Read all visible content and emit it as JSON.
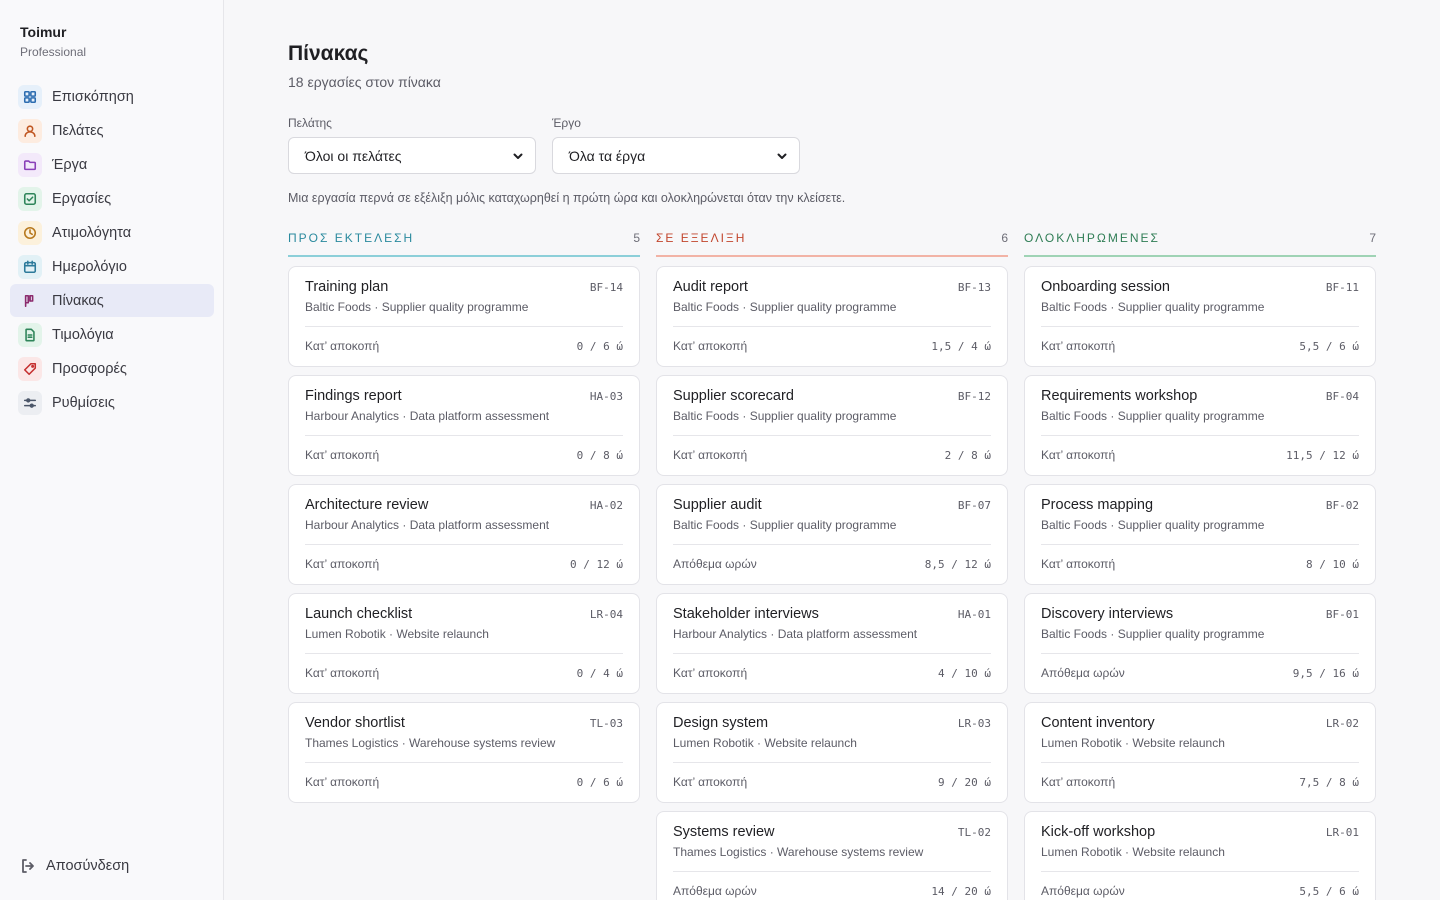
{
  "sidebar": {
    "brand": "Toimur",
    "plan": "Professional",
    "items": [
      {
        "label": "Επισκόπηση",
        "icon": "grid-icon",
        "color": "#2b6cb0",
        "bg": "#e6f0fa"
      },
      {
        "label": "Πελάτες",
        "icon": "user-icon",
        "color": "#c05621",
        "bg": "#fdece0"
      },
      {
        "label": "Έργα",
        "icon": "folder-icon",
        "color": "#8a3fb8",
        "bg": "#f3e9fa"
      },
      {
        "label": "Εργασίες",
        "icon": "checkbox-icon",
        "color": "#2f855a",
        "bg": "#e3f4ea"
      },
      {
        "label": "Ατιμολόγητα",
        "icon": "clock-icon",
        "color": "#b7791f",
        "bg": "#fcf1dc"
      },
      {
        "label": "Ημερολόγιο",
        "icon": "calendar-icon",
        "color": "#2c7a9b",
        "bg": "#e2f1f6"
      },
      {
        "label": "Πίνακας",
        "icon": "kanban-icon",
        "color": "#8b2b6d",
        "bg": "transparent",
        "active": true
      },
      {
        "label": "Τιμολόγια",
        "icon": "invoice-icon",
        "color": "#2f855a",
        "bg": "#e3f4ea"
      },
      {
        "label": "Προσφορές",
        "icon": "tag-icon",
        "color": "#c53030",
        "bg": "#fbe7e7"
      },
      {
        "label": "Ρυθμίσεις",
        "icon": "sliders-icon",
        "color": "#4a5568",
        "bg": "#eceef2"
      }
    ],
    "logout": "Αποσύνδεση"
  },
  "header": {
    "title": "Πίνακας",
    "subtitle": "18 εργασίες στον πίνακα"
  },
  "filters": {
    "client_label": "Πελάτης",
    "client_value": "Όλοι οι πελάτες",
    "project_label": "Έργο",
    "project_value": "Όλα τα έργα"
  },
  "hint": "Μια εργασία περνά σε εξέλιξη μόλις καταχωρηθεί η πρώτη ώρα και ολοκληρώνεται όταν την κλείσετε.",
  "columns": [
    {
      "title": "ΠΡΟΣ ΕΚΤΕΛΕΣΗ",
      "count": "5",
      "color": "#2a8a9e",
      "accent": "#8ccfd9",
      "cards": [
        {
          "title": "Training plan",
          "code": "BF-14",
          "meta": "Baltic Foods · Supplier quality programme",
          "status": "Κατ’ αποκοπή",
          "hours": "0 / 6 ώ"
        },
        {
          "title": "Findings report",
          "code": "HA-03",
          "meta": "Harbour Analytics · Data platform assessment",
          "status": "Κατ’ αποκοπή",
          "hours": "0 / 8 ώ"
        },
        {
          "title": "Architecture review",
          "code": "HA-02",
          "meta": "Harbour Analytics · Data platform assessment",
          "status": "Κατ’ αποκοπή",
          "hours": "0 / 12 ώ"
        },
        {
          "title": "Launch checklist",
          "code": "LR-04",
          "meta": "Lumen Robotik · Website relaunch",
          "status": "Κατ’ αποκοπή",
          "hours": "0 / 4 ώ"
        },
        {
          "title": "Vendor shortlist",
          "code": "TL-03",
          "meta": "Thames Logistics · Warehouse systems review",
          "status": "Κατ’ αποκοπή",
          "hours": "0 / 6 ώ"
        }
      ]
    },
    {
      "title": "ΣΕ ΕΞΕΛΙΞΗ",
      "count": "6",
      "color": "#c2452d",
      "accent": "#f2b3a6",
      "cards": [
        {
          "title": "Audit report",
          "code": "BF-13",
          "meta": "Baltic Foods · Supplier quality programme",
          "status": "Κατ’ αποκοπή",
          "hours": "1,5 / 4 ώ"
        },
        {
          "title": "Supplier scorecard",
          "code": "BF-12",
          "meta": "Baltic Foods · Supplier quality programme",
          "status": "Κατ’ αποκοπή",
          "hours": "2 / 8 ώ"
        },
        {
          "title": "Supplier audit",
          "code": "BF-07",
          "meta": "Baltic Foods · Supplier quality programme",
          "status": "Απόθεμα ωρών",
          "hours": "8,5 / 12 ώ"
        },
        {
          "title": "Stakeholder interviews",
          "code": "HA-01",
          "meta": "Harbour Analytics · Data platform assessment",
          "status": "Κατ’ αποκοπή",
          "hours": "4 / 10 ώ"
        },
        {
          "title": "Design system",
          "code": "LR-03",
          "meta": "Lumen Robotik · Website relaunch",
          "status": "Κατ’ αποκοπή",
          "hours": "9 / 20 ώ"
        },
        {
          "title": "Systems review",
          "code": "TL-02",
          "meta": "Thames Logistics · Warehouse systems review",
          "status": "Απόθεμα ωρών",
          "hours": "14 / 20 ώ"
        }
      ]
    },
    {
      "title": "ΟΛΟΚΛΗΡΩΜΕΝΕΣ",
      "count": "7",
      "color": "#2f7d55",
      "accent": "#9fd3b5",
      "cards": [
        {
          "title": "Onboarding session",
          "code": "BF-11",
          "meta": "Baltic Foods · Supplier quality programme",
          "status": "Κατ’ αποκοπή",
          "hours": "5,5 / 6 ώ"
        },
        {
          "title": "Requirements workshop",
          "code": "BF-04",
          "meta": "Baltic Foods · Supplier quality programme",
          "status": "Κατ’ αποκοπή",
          "hours": "11,5 / 12 ώ"
        },
        {
          "title": "Process mapping",
          "code": "BF-02",
          "meta": "Baltic Foods · Supplier quality programme",
          "status": "Κατ’ αποκοπή",
          "hours": "8 / 10 ώ"
        },
        {
          "title": "Discovery interviews",
          "code": "BF-01",
          "meta": "Baltic Foods · Supplier quality programme",
          "status": "Απόθεμα ωρών",
          "hours": "9,5 / 16 ώ"
        },
        {
          "title": "Content inventory",
          "code": "LR-02",
          "meta": "Lumen Robotik · Website relaunch",
          "status": "Κατ’ αποκοπή",
          "hours": "7,5 / 8 ώ"
        },
        {
          "title": "Kick-off workshop",
          "code": "LR-01",
          "meta": "Lumen Robotik · Website relaunch",
          "status": "Απόθεμα ωρών",
          "hours": "5,5 / 6 ώ"
        }
      ]
    }
  ]
}
